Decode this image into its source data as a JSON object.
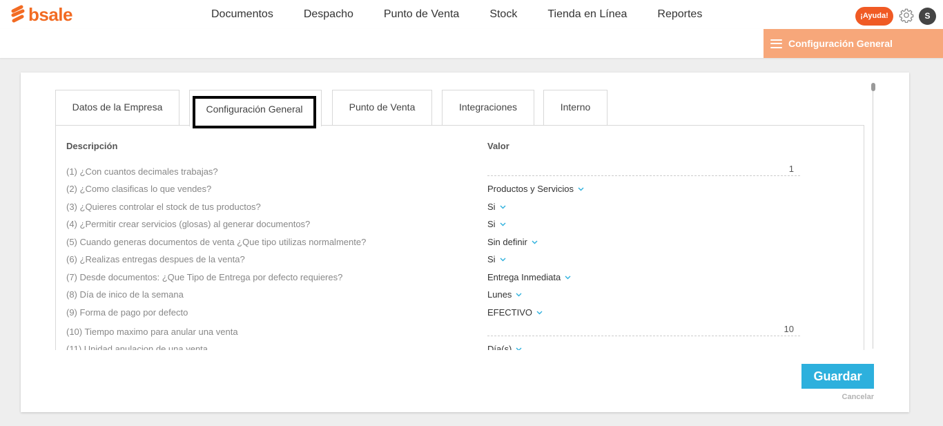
{
  "brand": {
    "name": "bsale",
    "color": "#f26b23"
  },
  "nav": {
    "items": [
      {
        "label": "Documentos"
      },
      {
        "label": "Despacho"
      },
      {
        "label": "Punto de Venta"
      },
      {
        "label": "Stock"
      },
      {
        "label": "Tienda en Línea"
      },
      {
        "label": "Reportes"
      }
    ]
  },
  "header": {
    "help_label": "¡Ayuda!",
    "settings_icon": "gear-icon",
    "avatar_initial": "S"
  },
  "section_button": {
    "label": "Configuración General",
    "icon": "hamburger-icon"
  },
  "tabs": [
    {
      "label": "Datos de la Empresa"
    },
    {
      "label": "Configuración General",
      "active": true
    },
    {
      "label": "Punto de Venta"
    },
    {
      "label": "Integraciones"
    },
    {
      "label": "Interno"
    }
  ],
  "table": {
    "headers": {
      "description": "Descripción",
      "value": "Valor"
    },
    "rows": [
      {
        "description": "(1) ¿Con cuantos decimales trabajas?",
        "value": "1",
        "type": "number"
      },
      {
        "description": "(2) ¿Como clasificas lo que vendes?",
        "value": "Productos y Servicios",
        "type": "select"
      },
      {
        "description": "(3) ¿Quieres controlar el stock de tus productos?",
        "value": "Si",
        "type": "select"
      },
      {
        "description": "(4) ¿Permitir crear servicios (glosas) al generar documentos?",
        "value": "Si",
        "type": "select"
      },
      {
        "description": "(5) Cuando generas documentos de venta ¿Que tipo utilizas normalmente?",
        "value": "Sin definir",
        "type": "select"
      },
      {
        "description": "(6) ¿Realizas entregas despues de la venta?",
        "value": "Si",
        "type": "select"
      },
      {
        "description": "(7) Desde documentos: ¿Que Tipo de Entrega por defecto requieres?",
        "value": "Entrega Inmediata",
        "type": "select"
      },
      {
        "description": "(8) Día de inico de la semana",
        "value": "Lunes",
        "type": "select"
      },
      {
        "description": "(9) Forma de pago por defecto",
        "value": "EFECTIVO",
        "type": "select"
      },
      {
        "description": "(10) Tiempo maximo para anular una venta",
        "value": "10",
        "type": "number"
      },
      {
        "description": "(11) Unidad anulacion de una venta",
        "value": "Día(s)",
        "type": "select"
      }
    ]
  },
  "actions": {
    "save_label": "Guardar",
    "cancel_label": "Cancelar"
  },
  "colors": {
    "accent_orange": "#f26b23",
    "section_button_bg": "#f7a77a",
    "help_button_bg": "#f05a24",
    "save_button_bg": "#2db0dd",
    "chevron": "#2db0dd"
  }
}
